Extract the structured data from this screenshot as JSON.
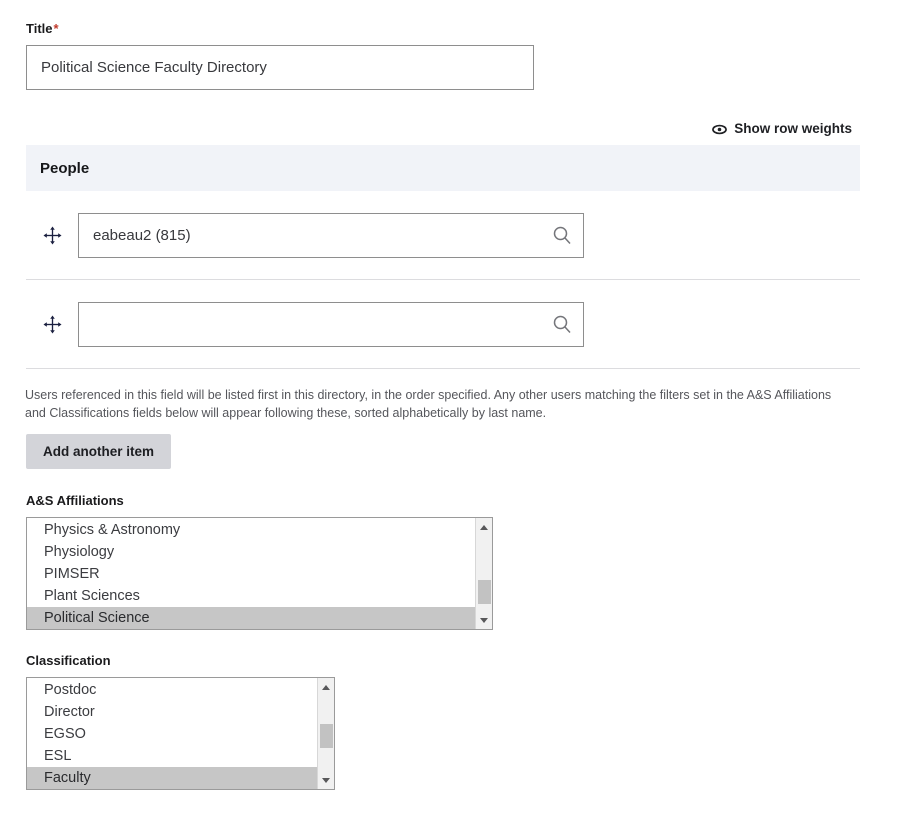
{
  "title_field": {
    "label": "Title",
    "required_mark": "*",
    "value": "Political Science Faculty Directory",
    "placeholder": ""
  },
  "row_weights": {
    "label": "Show row weights",
    "icon": "eye-icon"
  },
  "people_table": {
    "header": "People",
    "rows": [
      {
        "drag_icon": "move-cross-icon",
        "value": "eabeau2 (815)",
        "placeholder": "",
        "search_icon": "search-icon"
      },
      {
        "drag_icon": "move-cross-icon",
        "value": "",
        "placeholder": "",
        "search_icon": "search-icon"
      }
    ],
    "description": "Users referenced in this field will be listed first in this directory, in the order specified. Any other users matching the filters set in the A&S Affiliations and Classifications fields below will appear following these, sorted alphabetically by last name.",
    "add_button": "Add another item"
  },
  "affiliations": {
    "label": "A&S Affiliations",
    "options": [
      {
        "label": "Physics & Astronomy",
        "selected": false
      },
      {
        "label": "Physiology",
        "selected": false
      },
      {
        "label": "PIMSER",
        "selected": false
      },
      {
        "label": "Plant Sciences",
        "selected": false
      },
      {
        "label": "Political Science",
        "selected": true
      }
    ]
  },
  "classification": {
    "label": "Classification",
    "options": [
      {
        "label": "Postdoc",
        "selected": false
      },
      {
        "label": "Director",
        "selected": false
      },
      {
        "label": "EGSO",
        "selected": false
      },
      {
        "label": "ESL",
        "selected": false
      },
      {
        "label": "Faculty",
        "selected": true
      }
    ]
  },
  "colors": {
    "required": "#c0392b",
    "header_bg": "#f1f3f8",
    "selected_option": "#c6c6c6",
    "button_bg": "#d3d4d9"
  }
}
